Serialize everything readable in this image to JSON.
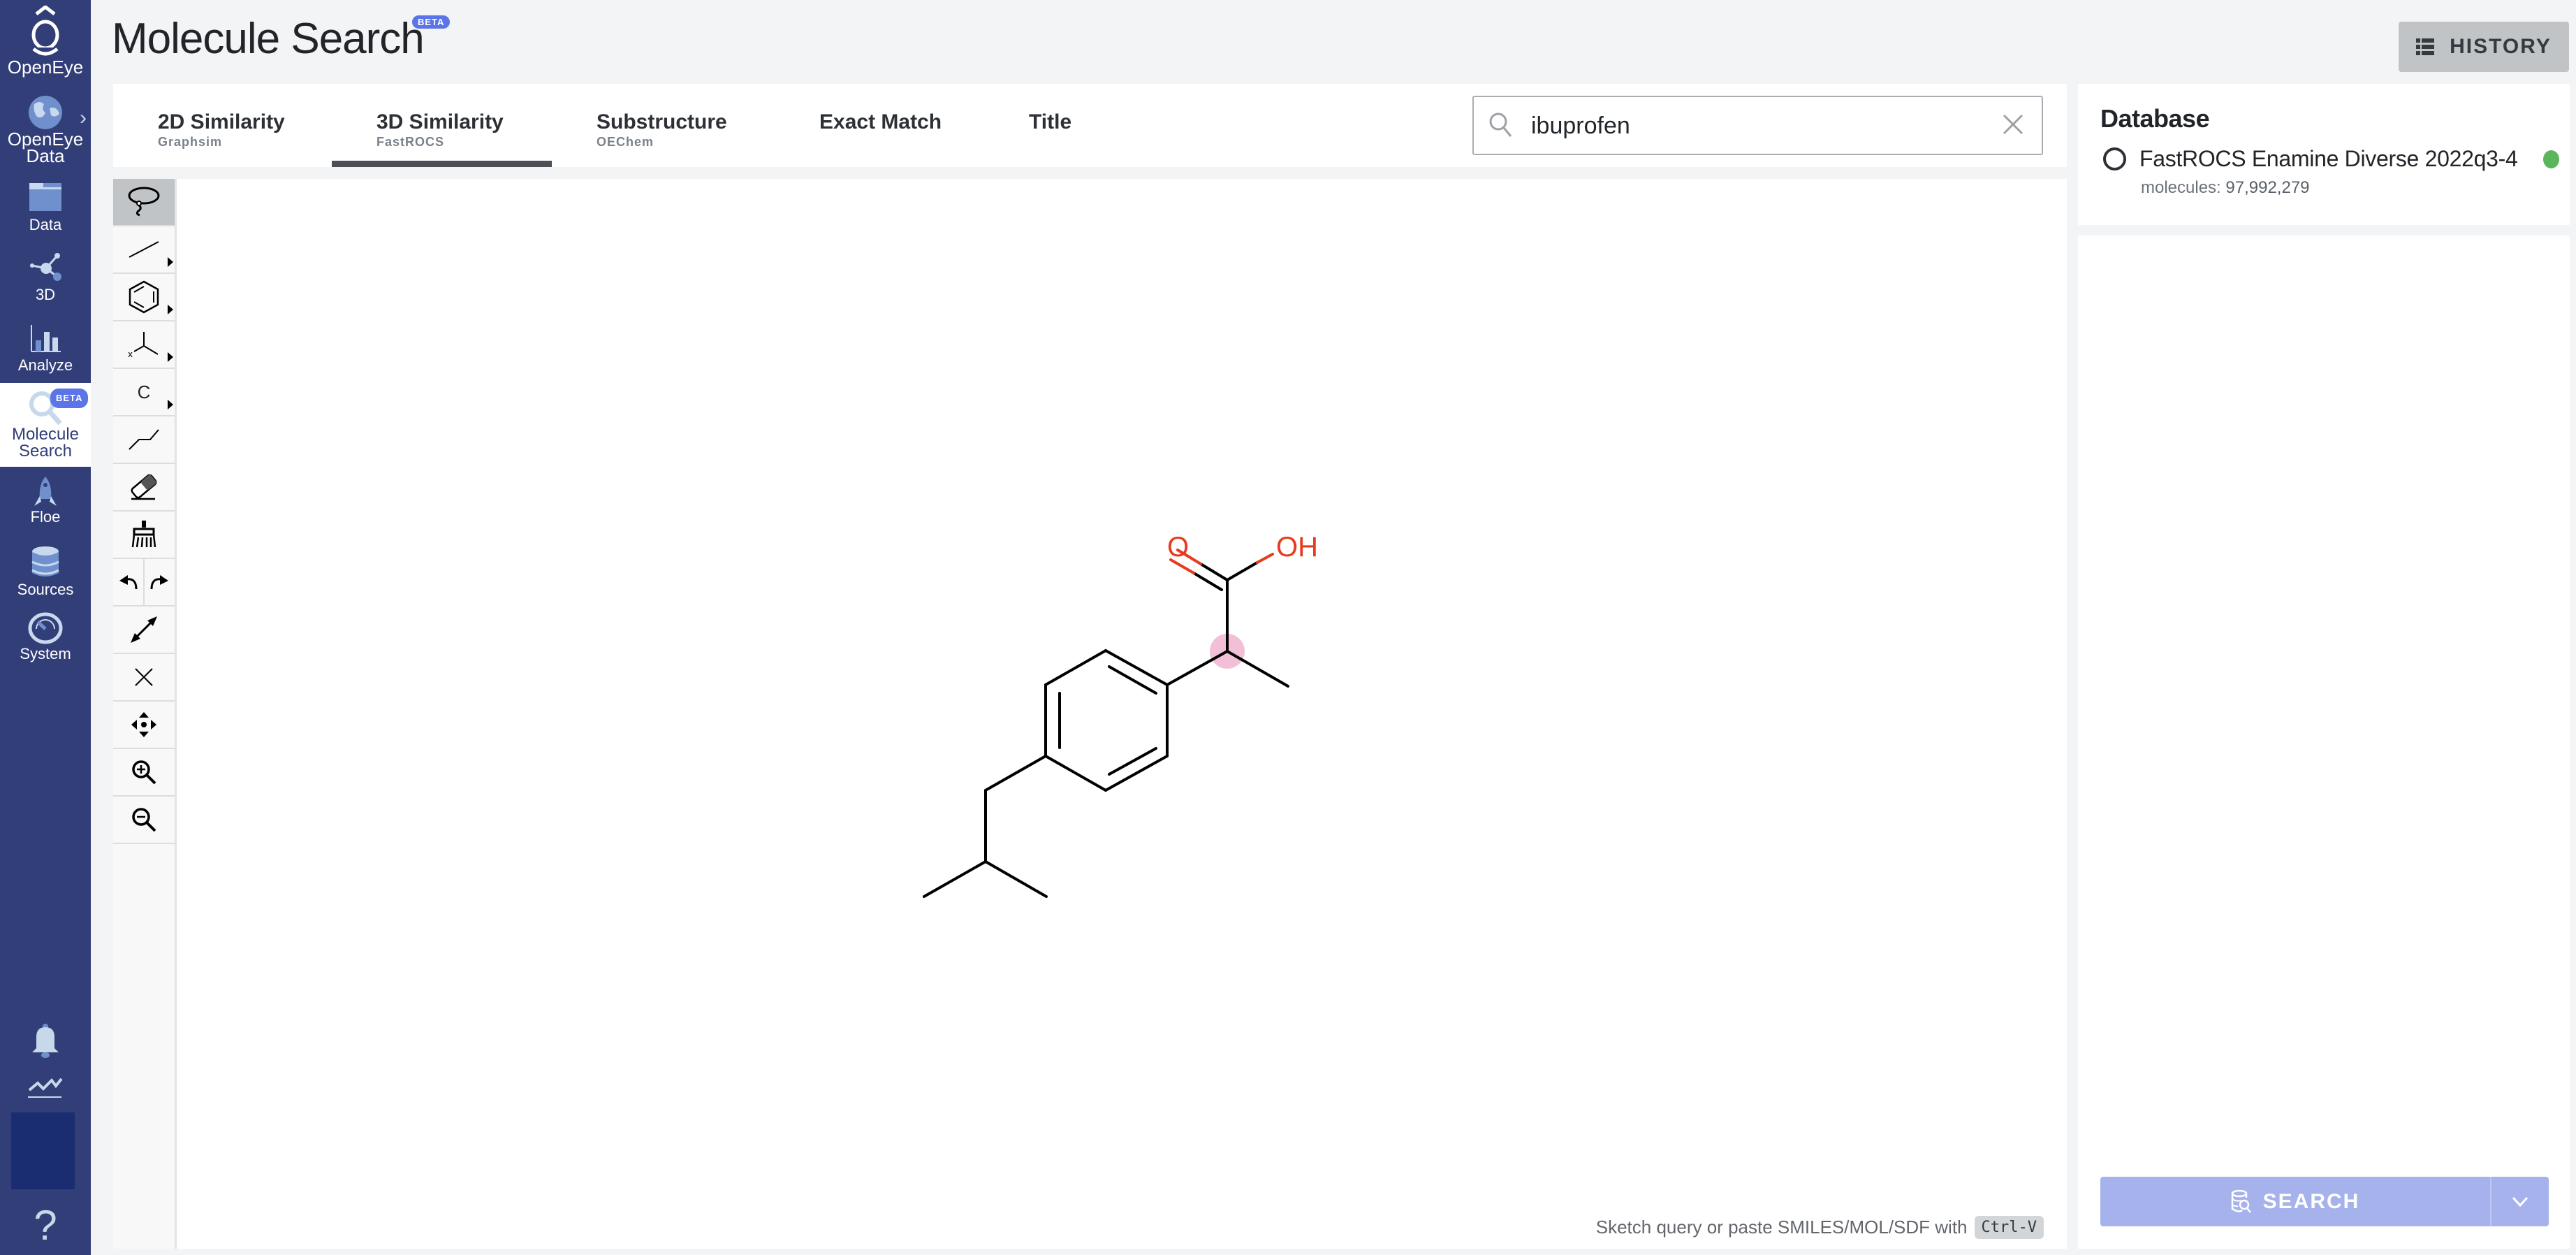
{
  "sidebar": {
    "logo_label": "OpenEye",
    "items": [
      {
        "id": "openeye-data",
        "label_line1": "OpenEye",
        "label_line2": "Data",
        "icon": "globe-icon",
        "has_submenu": true
      },
      {
        "id": "data",
        "label_line1": "Data",
        "label_line2": "",
        "icon": "folder-icon"
      },
      {
        "id": "3d",
        "label_line1": "3D",
        "label_line2": "",
        "icon": "molecule-nodes-icon"
      },
      {
        "id": "analyze",
        "label_line1": "Analyze",
        "label_line2": "",
        "icon": "bar-chart-icon"
      },
      {
        "id": "molecule-search",
        "label_line1": "Molecule",
        "label_line2": "Search",
        "icon": "magnifier-icon",
        "badge": "BETA",
        "active": true
      },
      {
        "id": "floe",
        "label_line1": "Floe",
        "label_line2": "",
        "icon": "rocket-icon"
      },
      {
        "id": "sources",
        "label_line1": "Sources",
        "label_line2": "",
        "icon": "database-icon"
      },
      {
        "id": "system",
        "label_line1": "System",
        "label_line2": "",
        "icon": "gauge-icon"
      }
    ],
    "bottom": [
      "bell-icon",
      "activity-icon",
      "user-avatar",
      "help-icon"
    ],
    "help_label": "?"
  },
  "header": {
    "title": "Molecule Search",
    "title_badge": "BETA",
    "history_label": "HISTORY"
  },
  "tabs": [
    {
      "label": "2D Similarity",
      "sub": "Graphsim",
      "active": false
    },
    {
      "label": "3D Similarity",
      "sub": "FastROCS",
      "active": true
    },
    {
      "label": "Substructure",
      "sub": "OEChem",
      "active": false
    },
    {
      "label": "Exact Match",
      "sub": "",
      "active": false
    },
    {
      "label": "Title",
      "sub": "",
      "active": false
    }
  ],
  "search": {
    "value": "ibuprofen",
    "placeholder": ""
  },
  "sketcher": {
    "tools": [
      "lasso-select",
      "bond",
      "ring",
      "chain-template",
      "atom-element",
      "chain",
      "eraser",
      "clean-brush",
      "undo",
      "redo",
      "resize",
      "clear",
      "move",
      "zoom-in",
      "zoom-out"
    ],
    "atom_tool_label": "C",
    "hint_text": "Sketch query or paste SMILES/MOL/SDF with",
    "hint_key": "Ctrl-V",
    "molecule": {
      "name": "ibuprofen",
      "oxygen_label": "O",
      "hydroxyl_label": "OH",
      "atom_color_oxygen": "#e63b1f",
      "highlight_color": "#f3bfd7"
    }
  },
  "database": {
    "title": "Database",
    "name": "FastROCS Enamine Diverse 2022q3-4",
    "count_label": "molecules:",
    "count_value": "97,992,279",
    "status_color": "#5bb55a",
    "selected": false
  },
  "actions": {
    "search_label": "SEARCH",
    "search_enabled": false
  },
  "colors": {
    "sidebar_bg": "#323e78",
    "accent": "#5b74e8",
    "search_btn_disabled": "#a6b2ec"
  }
}
